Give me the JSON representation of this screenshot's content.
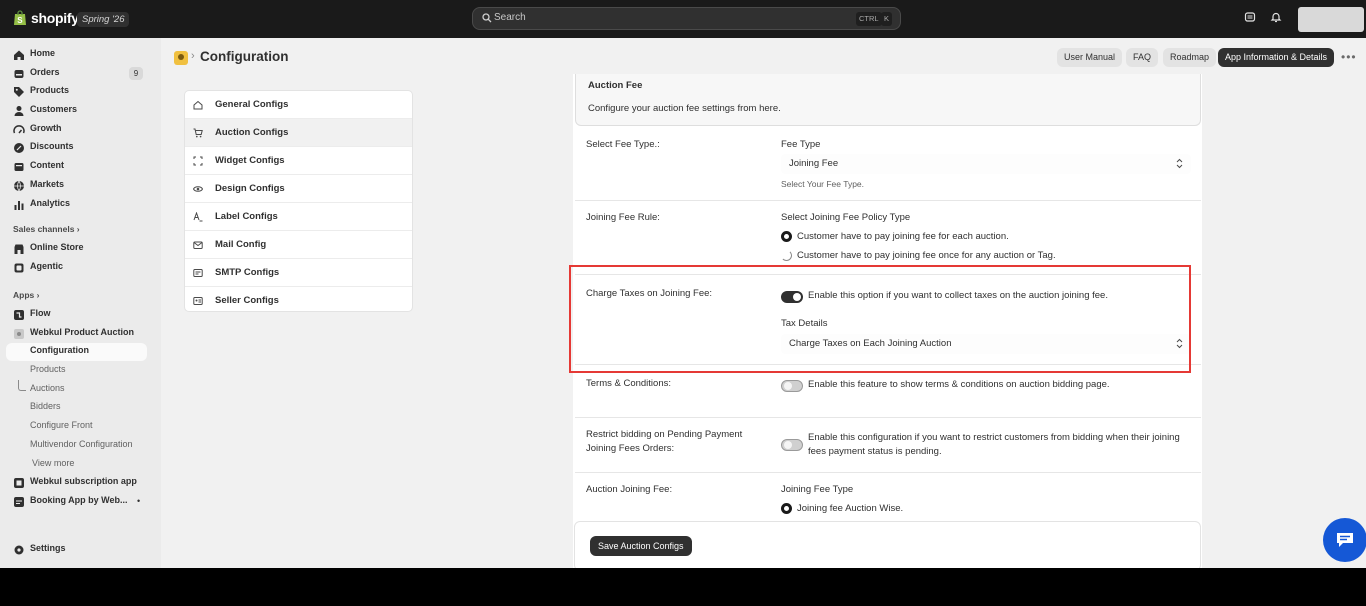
{
  "topbar": {
    "brand": "shopify",
    "edition": "Spring '26",
    "search_placeholder": "Search",
    "shortcut_keys": [
      "CTRL",
      "K"
    ]
  },
  "sidebar": {
    "items": [
      {
        "label": "Home",
        "icon": "home-icon"
      },
      {
        "label": "Orders",
        "icon": "orders-icon",
        "count": "9"
      },
      {
        "label": "Products",
        "icon": "tag-icon"
      },
      {
        "label": "Customers",
        "icon": "person-icon"
      },
      {
        "label": "Growth",
        "icon": "growth-icon"
      },
      {
        "label": "Discounts",
        "icon": "discount-icon"
      },
      {
        "label": "Content",
        "icon": "content-icon"
      },
      {
        "label": "Markets",
        "icon": "globe-icon"
      },
      {
        "label": "Analytics",
        "icon": "chart-icon"
      }
    ],
    "sales_channels_heading": "Sales channels",
    "sales_channels": [
      {
        "label": "Online Store",
        "icon": "store-icon"
      },
      {
        "label": "Agentic",
        "icon": "agentic-icon"
      }
    ],
    "apps_heading": "Apps",
    "apps": [
      {
        "label": "Flow",
        "icon": "flow-icon"
      },
      {
        "label": "Webkul Product Auction",
        "icon": "app-icon"
      }
    ],
    "auction_sub": [
      "Configuration",
      "Products",
      "Auctions",
      "Bidders",
      "Configure Front",
      "Multivendor Configuration",
      "View more"
    ],
    "other_apps": [
      {
        "label": "Webkul subscription app",
        "icon": "app-icon"
      },
      {
        "label": "Booking App by Web...",
        "icon": "app-icon"
      }
    ],
    "settings": "Settings"
  },
  "header": {
    "title": "Configuration",
    "buttons": [
      "User Manual",
      "FAQ",
      "Roadmap",
      "App Information & Details"
    ]
  },
  "config_menu": [
    {
      "label": "General Configs",
      "icon": "home-icon"
    },
    {
      "label": "Auction Configs",
      "icon": "cart-icon",
      "active": true
    },
    {
      "label": "Widget Configs",
      "icon": "widget-icon"
    },
    {
      "label": "Design Configs",
      "icon": "eye-icon"
    },
    {
      "label": "Label Configs",
      "icon": "label-icon"
    },
    {
      "label": "Mail Config",
      "icon": "mail-icon"
    },
    {
      "label": "SMTP Configs",
      "icon": "smtp-icon"
    },
    {
      "label": "Seller Configs",
      "icon": "seller-icon"
    }
  ],
  "auction_fee": {
    "title": "Auction Fee",
    "description": "Configure your auction fee settings from here."
  },
  "fee_type": {
    "row_label": "Select Fee Type.:",
    "field_label": "Fee Type",
    "value": "Joining Fee",
    "help": "Select Your Fee Type."
  },
  "joining_rule": {
    "row_label": "Joining Fee Rule:",
    "field_label": "Select Joining Fee Policy Type",
    "options": [
      {
        "label": "Customer have to pay joining fee for each auction.",
        "selected": true
      },
      {
        "label": "Customer have to pay joining fee once for any auction or Tag.",
        "selected": false
      }
    ]
  },
  "charge_taxes": {
    "row_label": "Charge Taxes on Joining Fee:",
    "toggle_on": true,
    "toggle_label": "Enable this option if you want to collect taxes on the auction joining fee.",
    "tax_label": "Tax Details",
    "tax_value": "Charge Taxes on Each Joining Auction"
  },
  "terms": {
    "row_label": "Terms & Conditions:",
    "toggle_on": false,
    "toggle_label": "Enable this feature to show terms & conditions on auction bidding page."
  },
  "restrict": {
    "row_label_1": "Restrict bidding on Pending Payment",
    "row_label_2": "Joining Fees Orders:",
    "toggle_on": false,
    "toggle_label_1": "Enable this configuration if you want to restrict customers from bidding when their joining",
    "toggle_label_2": "fees payment status is pending."
  },
  "joining_fee": {
    "row_label": "Auction Joining Fee:",
    "field_label": "Joining Fee Type",
    "option": "Joining fee Auction Wise."
  },
  "save_label": "Save Auction Configs",
  "colors": {
    "highlight": "#e53935",
    "chat": "#1558d6",
    "topbar": "#1a1a1a"
  }
}
